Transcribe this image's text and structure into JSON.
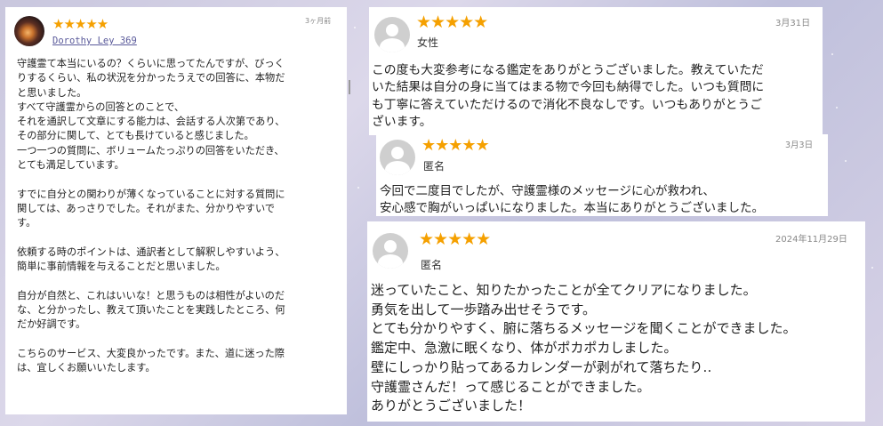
{
  "reviews": [
    {
      "stars": "★★★★★",
      "date": "3ヶ月前",
      "name": "Dorothy Ley 369",
      "avatar": "user-photo-avatar",
      "lines": [
        "守護霊て本当にいるの？くらいに思ってたんですが、びっく",
        "りするくらい、私の状況を分かったうえでの回答に、本物だ",
        "と思いました。",
        "すべて守護霊からの回答とのことで、",
        "それを通訳して文章にする能力は、会話する人次第であり、",
        "その部分に関して、とても長けていると感じました。",
        "一つ一つの質問に、ボリュームたっぷりの回答をいただき、",
        "とても満足しています。",
        "",
        "すでに自分との関わりが薄くなっていることに対する質問に",
        "関しては、あっさりでした。それがまた、分かりやすいで",
        "す。",
        "",
        "依頼する時のポイントは、通訳者として解釈しやすいよう、",
        "簡単に事前情報を与えることだと思いました。",
        "",
        "自分が自然と、これはいいな！と思うものは相性がよいのだ",
        "な、と分かったし、教えて頂いたことを実践したところ、何",
        "だか好調です。",
        "",
        "こちらのサービス、大変良かったです。また、道に迷った際",
        "は、宜しくお願いいたします。"
      ]
    },
    {
      "stars": "★★★★★",
      "date": "3月31日",
      "name": "女性",
      "avatar": "default-user-icon",
      "lines": [
        "この度も大変参考になる鑑定をありがとうございました。教えていただ",
        "いた結果は自分の身に当てはまる物で今回も納得でした。いつも質問に",
        "も丁寧に答えていただけるので消化不良なしです。いつもありがとうご",
        "ざいます。"
      ]
    },
    {
      "stars": "★★★★★",
      "date": "3月3日",
      "name": "匿名",
      "avatar": "default-user-icon",
      "lines": [
        "今回で二度目でしたが、守護霊様のメッセージに心が救われ、",
        "安心感で胸がいっぱいになりました。本当にありがとうございました。"
      ]
    },
    {
      "stars": "★★★★★",
      "date": "2024年11月29日",
      "name": "匿名",
      "avatar": "default-user-icon",
      "lines": [
        "迷っていたこと、知りたかったことが全てクリアになりました。",
        "勇気を出して一歩踏み出せそうです。",
        "とても分かりやすく、腑に落ちるメッセージを聞くことができました。",
        "鑑定中、急激に眠くなり、体がポカポカしました。",
        "壁にしっかり貼ってあるカレンダーが剥がれて落ちたり‥",
        "守護霊さんだ！って感じることができました。",
        "ありがとうございました！"
      ]
    }
  ],
  "colors": {
    "star": "#f5a000",
    "date": "#888888",
    "link_name": "#5a5a9a",
    "background": "#d0cde3"
  }
}
